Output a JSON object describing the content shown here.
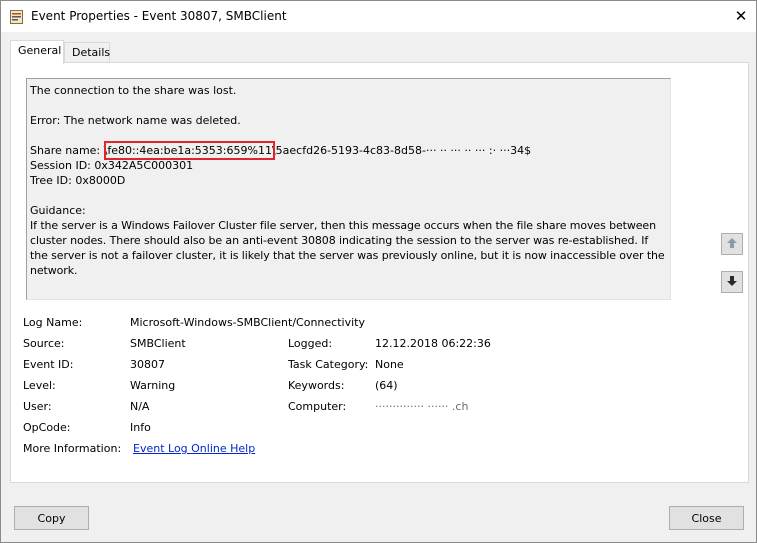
{
  "window": {
    "title": "Event Properties - Event 30807, SMBClient",
    "close_glyph": "✕"
  },
  "tabs": [
    {
      "label": "General",
      "active": true
    },
    {
      "label": "Details",
      "active": false
    }
  ],
  "message": {
    "line1": "The connection to the share was lost.",
    "line2": "Error: The network name was deleted.",
    "share_prefix": "Share name: \\",
    "share_highlighted": "fe80::4ea:be1a:5353:659%11",
    "share_suffix": "\\5aecfd26-5193-4c83-8d58-··· ·· ··· ·· ··· :· ···34$",
    "session_id": "Session ID: 0x342A5C000301",
    "tree_id": "Tree ID: 0x8000D",
    "guidance_label": "Guidance:",
    "guidance_text": "If the server is a Windows Failover Cluster file server, then this message occurs when the file share moves between cluster nodes. There should also be an anti-event 30808 indicating the session to the server was re-established. If the server is not a failover cluster, it is likely that the server was previously online, but it is now inaccessible over the network."
  },
  "fields": {
    "log_name_label": "Log Name:",
    "log_name_value": "Microsoft-Windows-SMBClient/Connectivity",
    "source_label": "Source:",
    "source_value": "SMBClient",
    "logged_label": "Logged:",
    "logged_value": "12.12.2018 06:22:36",
    "event_id_label": "Event ID:",
    "event_id_value": "30807",
    "task_category_label": "Task Category:",
    "task_category_value": "None",
    "level_label": "Level:",
    "level_value": "Warning",
    "keywords_label": "Keywords:",
    "keywords_value": "(64)",
    "user_label": "User:",
    "user_value": "N/A",
    "computer_label": "Computer:",
    "computer_value": "··············  ······ .ch",
    "opcode_label": "OpCode:",
    "opcode_value": "Info",
    "more_info_label": "More Information:",
    "more_info_link": "Event Log Online Help"
  },
  "buttons": {
    "copy": "Copy",
    "close": "Close"
  },
  "icons": {
    "app": "event-viewer-icon",
    "up": "arrow-up-icon",
    "down": "arrow-down-icon"
  }
}
